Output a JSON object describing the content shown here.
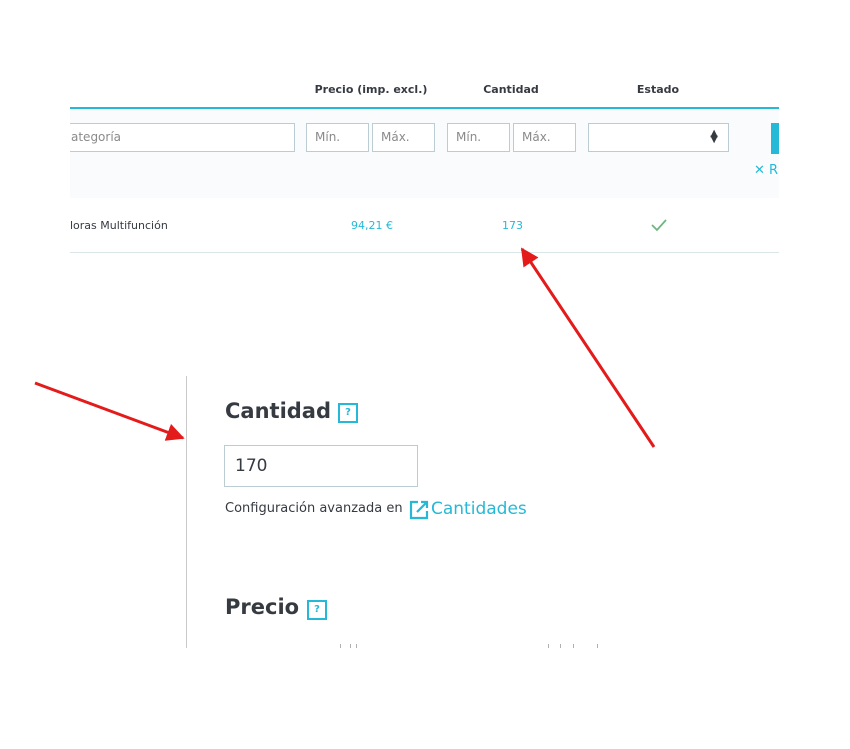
{
  "table": {
    "headers": {
      "price": "Precio (imp. excl.)",
      "quantity": "Cantidad",
      "status": "Estado"
    },
    "filters": {
      "category_placeholder": "ategoría",
      "price_min": "Mín.",
      "price_max": "Máx.",
      "qty_min": "Mín.",
      "qty_max": "Máx.",
      "reset_label": "✕ R"
    },
    "row": {
      "name": "loras Multifunción",
      "price": "94,21 €",
      "quantity": "173"
    }
  },
  "form": {
    "quantity": {
      "title": "Cantidad",
      "help": "?",
      "value": "170"
    },
    "advanced": {
      "text": "Configuración avanzada en",
      "link": "Cantidades"
    },
    "price": {
      "title": "Precio",
      "help": "?"
    }
  },
  "colors": {
    "accent": "#25b9d7",
    "text": "#363a41",
    "success": "#70b580",
    "annotation_arrow": "#e41b1b"
  }
}
